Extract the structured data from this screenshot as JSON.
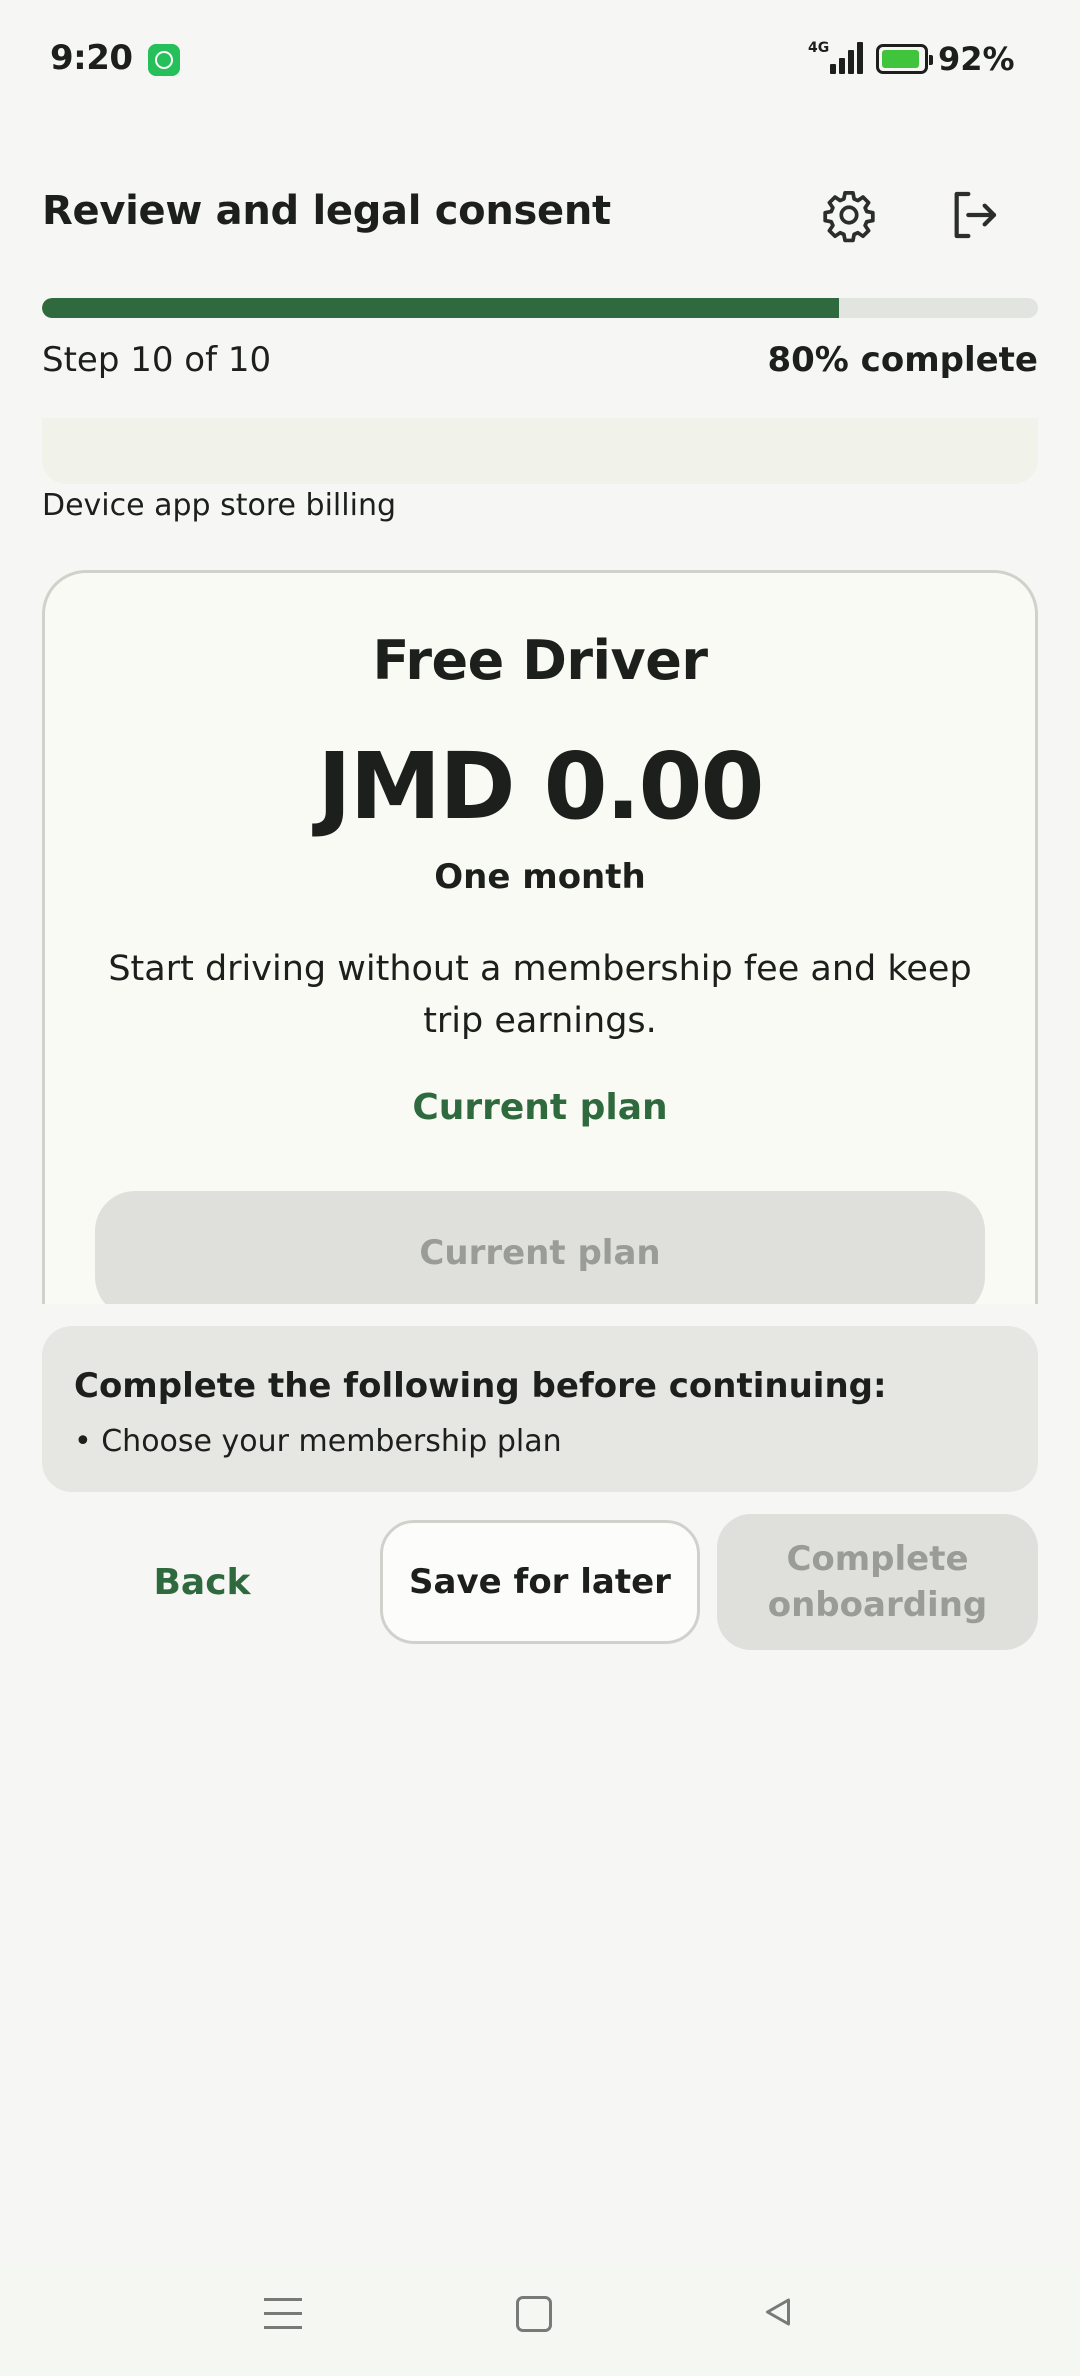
{
  "status_bar": {
    "time": "9:20",
    "network": "4G",
    "battery_percent": "92%",
    "icons": [
      "whatsapp-icon",
      "signal-icon",
      "battery-charging-icon"
    ]
  },
  "header": {
    "title": "Review and legal consent",
    "icons": [
      "gear-icon",
      "logout-icon"
    ]
  },
  "progress": {
    "fraction": 0.8,
    "step_label": "Step 10 of 10",
    "percent_label": "80% complete",
    "accent": "#2f6a3e"
  },
  "billing": {
    "label": "Device app store billing"
  },
  "plan": {
    "name": "Free Driver",
    "price": "JMD 0.00",
    "period": "One month",
    "description": "Start driving without a membership fee and keep trip earnings.",
    "status": "Current plan",
    "button_label": "Current plan"
  },
  "requirements": {
    "title": "Complete the following before continuing:",
    "items": [
      "• Choose your membership plan"
    ]
  },
  "actions": {
    "back": "Back",
    "save": "Save for later",
    "complete": "Complete onboarding"
  },
  "nav": {
    "icons": [
      "menu-icon",
      "home-icon",
      "back-icon"
    ]
  }
}
